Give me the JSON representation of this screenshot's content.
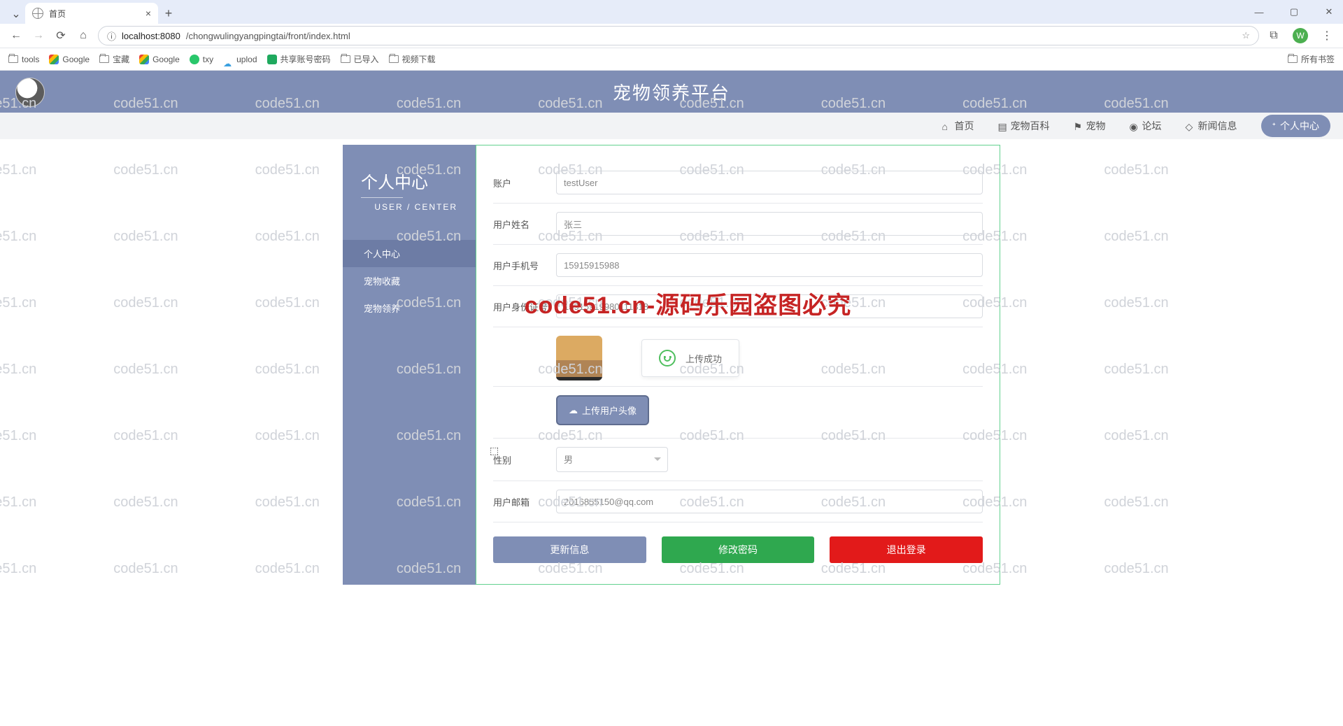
{
  "browser": {
    "tab_title": "首页",
    "url_host": "localhost:8080",
    "url_path": "/chongwulingyangpingtai/front/index.html",
    "avatar_letter": "W",
    "window": {
      "min": "—",
      "max": "▢",
      "close": "✕"
    },
    "bookmarks": [
      "tools",
      "Google",
      "宝藏",
      "Google",
      "txy",
      "uplod",
      "共享账号密码",
      "已导入",
      "视频下载"
    ],
    "bookmarks_right": "所有书签"
  },
  "header": {
    "title": "宠物领养平台"
  },
  "nav": {
    "items": [
      "首页",
      "宠物百科",
      "宠物",
      "论坛",
      "新闻信息"
    ],
    "pill": "个人中心"
  },
  "sidebar": {
    "title": "个人中心",
    "subtitle": "USER / CENTER",
    "items": [
      "个人中心",
      "宠物收藏",
      "宠物领养"
    ]
  },
  "form": {
    "account_label": "账户",
    "account_value": "testUser",
    "name_label": "用户姓名",
    "name_value": "张三",
    "phone_label": "用户手机号",
    "phone_value": "15915915988",
    "idcard_label": "用户身份证号",
    "idcard_value": "15915919980111818",
    "upload_btn": "上传用户头像",
    "toast": "上传成功",
    "gender_label": "性别",
    "gender_value": "男",
    "email_label": "用户邮箱",
    "email_value": "2016855150@qq.com",
    "btn_update": "更新信息",
    "btn_pwd": "修改密码",
    "btn_logout": "退出登录"
  },
  "watermark": {
    "text": "code51.cn",
    "big": "code51.cn-源码乐园盗图必究"
  }
}
